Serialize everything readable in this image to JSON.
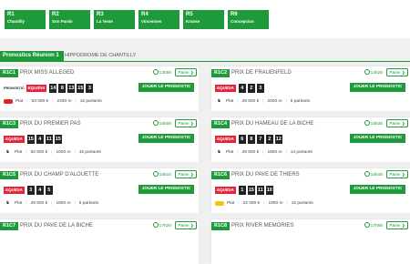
{
  "tabs": [
    {
      "num": "R1",
      "city": "Chantilly"
    },
    {
      "num": "R2",
      "city": "Son Pardo"
    },
    {
      "num": "R3",
      "city": "La Teste"
    },
    {
      "num": "R4",
      "city": "Vincennes"
    },
    {
      "num": "R5",
      "city": "Kranse"
    },
    {
      "num": "R6",
      "city": "Concepcion"
    }
  ],
  "header": {
    "tag": "Pronostics Réunion 1",
    "hippodrome": "HIPPODROME DE CHANTILLY"
  },
  "labels": {
    "pronostic": "PRONOSTIC",
    "equidia": "EQUIDIA",
    "jouer": "JOUER LE PRONOSTIC",
    "parier": "Parier ❯",
    "discipline": "Plat"
  },
  "races": [
    {
      "code": "R1C1",
      "name": "PRIX MISS ALLEGED",
      "time": "13h50",
      "nums": [
        "14",
        "8",
        "13",
        "15",
        "3"
      ],
      "prize": "53 000 €",
      "distance": "2400 m",
      "partants": "16 partants",
      "show_prono": true,
      "ic": "red"
    },
    {
      "code": "R1C2",
      "name": "PRIX DE FRAUENFELD",
      "time": "14h25",
      "nums": [
        "4",
        "2",
        "3"
      ],
      "prize": "28 000 €",
      "distance": "2000 m",
      "partants": "5 partants",
      "show_prono": false,
      "ic": "horse"
    },
    {
      "code": "R1C3",
      "name": "PRIX DU PREMIER PAS",
      "time": "15h00",
      "nums": [
        "15",
        "4",
        "11",
        "15"
      ],
      "prize": "50 000 €",
      "distance": "1000 m",
      "partants": "15 partants",
      "show_prono": false,
      "ic": "horse"
    },
    {
      "code": "R1C4",
      "name": "PRIX DU HAMEAU DE LA BICHE",
      "time": "15h35",
      "nums": [
        "6",
        "8",
        "7",
        "2",
        "12"
      ],
      "prize": "28 000 €",
      "distance": "1600 m",
      "partants": "14 partants",
      "show_prono": false,
      "ic": "horse"
    },
    {
      "code": "R1C5",
      "name": "PRIX DU CHAMP D'ALOUETTE",
      "time": "16h10",
      "nums": [
        "3",
        "4",
        "5"
      ],
      "prize": "28 000 €",
      "distance": "1800 m",
      "partants": "5 partants",
      "show_prono": false,
      "ic": "horse"
    },
    {
      "code": "R1C6",
      "name": "PRIX DU PAVE DE THIERS",
      "time": "16h45",
      "nums": [
        "1",
        "15",
        "11",
        "10"
      ],
      "prize": "22 000 €",
      "distance": "1900 m",
      "partants": "15 partants",
      "show_prono": false,
      "ic": "yellow"
    },
    {
      "code": "R1C7",
      "name": "PRIX DU PAVE DE LA BICHE",
      "time": "17h20",
      "nums": [],
      "prize": "",
      "distance": "",
      "partants": "",
      "show_prono": false,
      "ic": "none"
    },
    {
      "code": "R1C8",
      "name": "PRIX RIVER MEMORIES",
      "time": "17h55",
      "nums": [],
      "prize": "",
      "distance": "",
      "partants": "",
      "show_prono": false,
      "ic": "none"
    }
  ],
  "colors": {
    "accent": "#1f9a3a",
    "equidia": "#e8253d"
  }
}
